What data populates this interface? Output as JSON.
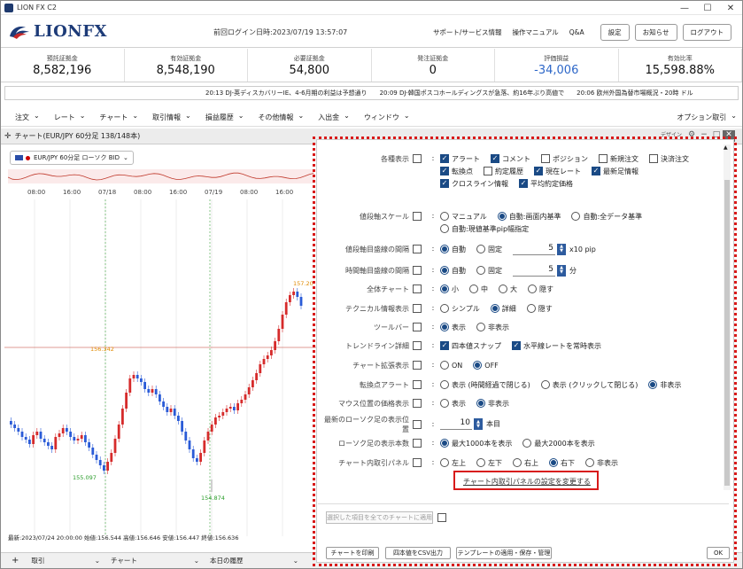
{
  "window": {
    "title": "LION FX C2",
    "btn_min": "—",
    "btn_max": "☐",
    "btn_close": "✕"
  },
  "header": {
    "logo_text": "LIONFX",
    "last_login": "前回ログイン日時:2023/07/19 13:57:07",
    "links": [
      "サポート/サービス情報",
      "操作マニュアル",
      "Q&A"
    ],
    "buttons": [
      "設定",
      "お知らせ",
      "ログアウト"
    ]
  },
  "account": [
    {
      "label": "預託証拠金",
      "value": "8,582,196"
    },
    {
      "label": "有効証拠金",
      "value": "8,548,190"
    },
    {
      "label": "必要証拠金",
      "value": "54,800"
    },
    {
      "label": "発注証拠金",
      "value": "0"
    },
    {
      "label": "評価損益",
      "value": "-34,006"
    },
    {
      "label": "有効比率",
      "value": "15,598.88%"
    }
  ],
  "ticker": [
    "20:13 DJ-英ディスカバリーIE、4-6月期の利益は予想通り",
    "20:09 DJ-韓国ポスコホールディングスが急落、約16年ぶり高値で",
    "20:06 欧州外国為替市場概況・20時 ドル"
  ],
  "menu": [
    "注文",
    "レート",
    "チャート",
    "取引情報",
    "損益履歴",
    "その他情報",
    "入出金",
    "ウィンドウ"
  ],
  "menu_right": "オプション取引",
  "chart": {
    "title": "チャート(EUR/JPY 60分足 138/148本)",
    "symbol": "EUR/JPY 60分足 ローソク BID",
    "time_labels": [
      "08:00",
      "16:00",
      "07/18",
      "08:00",
      "16:00",
      "07/19",
      "08:00",
      "16:00"
    ],
    "price_labels": [
      "157.20",
      "156.342",
      "155.097",
      "154.874"
    ],
    "status": "最新:2023/07/24 20:00:00 始値:156.544 高値:156.646 安値:156.447 終値:156.636",
    "colors": {
      "up": "#d62b2b",
      "down": "#2a5bd7",
      "high": "#e08a00",
      "low": "#2a9d2a"
    },
    "ctl": [
      "デザイン",
      "⚙",
      "−",
      "□",
      "✕"
    ]
  },
  "bottom_tabs": [
    "取引",
    "チャート",
    "本日の履歴"
  ],
  "settings": {
    "rows": [
      {
        "label": "各種表示",
        "checked": false,
        "opts": [
          {
            "t": "アラート",
            "k": "cb",
            "on": true
          },
          {
            "t": "コメント",
            "k": "cb",
            "on": true
          },
          {
            "t": "ポジション",
            "k": "cb",
            "on": false
          },
          {
            "t": "新規注文",
            "k": "cb",
            "on": false
          },
          {
            "t": "決済注文",
            "k": "cb",
            "on": false
          },
          {
            "t": "転換点",
            "k": "cb",
            "on": true
          },
          {
            "t": "約定履歴",
            "k": "cb",
            "on": false
          },
          {
            "t": "現在レート",
            "k": "cb",
            "on": true
          },
          {
            "t": "最新足情報",
            "k": "cb",
            "on": true
          },
          {
            "t": "クロスライン情報",
            "k": "cb",
            "on": true
          },
          {
            "t": "平均約定価格",
            "k": "cb",
            "on": true
          }
        ]
      },
      {
        "label": "値段軸スケール",
        "checked": false,
        "opts": [
          {
            "t": "マニュアル",
            "k": "rb",
            "on": false
          },
          {
            "t": "自動:画面内基準",
            "k": "rb",
            "on": true
          },
          {
            "t": "自動:全データ基準",
            "k": "rb",
            "on": false
          },
          {
            "t": "自動:現値基準pip幅指定",
            "k": "rb",
            "on": false
          }
        ]
      },
      {
        "label": "値段軸目盛線の間隔",
        "checked": false,
        "opts": [
          {
            "t": "自動",
            "k": "rb",
            "on": true
          },
          {
            "t": "固定",
            "k": "rb",
            "on": false
          }
        ],
        "num": "5",
        "unit": "x10 pip"
      },
      {
        "label": "時間軸目盛線の間隔",
        "checked": false,
        "opts": [
          {
            "t": "自動",
            "k": "rb",
            "on": true
          },
          {
            "t": "固定",
            "k": "rb",
            "on": false
          }
        ],
        "num": "5",
        "unit": "分"
      },
      {
        "label": "全体チャート",
        "checked": false,
        "opts": [
          {
            "t": "小",
            "k": "rb",
            "on": true
          },
          {
            "t": "中",
            "k": "rb",
            "on": false
          },
          {
            "t": "大",
            "k": "rb",
            "on": false
          },
          {
            "t": "隠す",
            "k": "rb",
            "on": false
          }
        ]
      },
      {
        "label": "テクニカル情報表示",
        "checked": false,
        "opts": [
          {
            "t": "シンプル",
            "k": "rb",
            "on": false
          },
          {
            "t": "詳細",
            "k": "rb",
            "on": true
          },
          {
            "t": "隠す",
            "k": "rb",
            "on": false
          }
        ]
      },
      {
        "label": "ツールバー",
        "checked": false,
        "opts": [
          {
            "t": "表示",
            "k": "rb",
            "on": true
          },
          {
            "t": "非表示",
            "k": "rb",
            "on": false
          }
        ]
      },
      {
        "label": "トレンドライン詳細",
        "checked": false,
        "opts": [
          {
            "t": "四本値スナップ",
            "k": "cb",
            "on": true
          },
          {
            "t": "水平線レートを常時表示",
            "k": "cb",
            "on": true
          }
        ]
      },
      {
        "label": "チャート拡張表示",
        "checked": false,
        "opts": [
          {
            "t": "ON",
            "k": "rb",
            "on": false
          },
          {
            "t": "OFF",
            "k": "rb",
            "on": true
          }
        ]
      },
      {
        "label": "転換点アラート",
        "checked": false,
        "opts": [
          {
            "t": "表示 (時間経過で閉じる)",
            "k": "rb",
            "on": false
          },
          {
            "t": "表示 (クリックして閉じる)",
            "k": "rb",
            "on": false
          },
          {
            "t": "非表示",
            "k": "rb",
            "on": true
          }
        ]
      },
      {
        "label": "マウス位置の価格表示",
        "checked": false,
        "opts": [
          {
            "t": "表示",
            "k": "rb",
            "on": false
          },
          {
            "t": "非表示",
            "k": "rb",
            "on": true
          }
        ]
      },
      {
        "label": "最新のローソク足の表示位置",
        "checked": false,
        "opts": [],
        "num": "10",
        "unit": "本目"
      },
      {
        "label": "ローソク足の表示本数",
        "checked": false,
        "opts": [
          {
            "t": "最大1000本を表示",
            "k": "rb",
            "on": true
          },
          {
            "t": "最大2000本を表示",
            "k": "rb",
            "on": false
          }
        ]
      },
      {
        "label": "チャート内取引パネル",
        "checked": false,
        "opts": [
          {
            "t": "左上",
            "k": "rb",
            "on": false
          },
          {
            "t": "左下",
            "k": "rb",
            "on": false
          },
          {
            "t": "右上",
            "k": "rb",
            "on": false
          },
          {
            "t": "右下",
            "k": "rb",
            "on": true
          },
          {
            "t": "非表示",
            "k": "rb",
            "on": false
          }
        ]
      }
    ],
    "link": "チャート内取引パネルの設定を変更する",
    "apply_all": "選択した項目を全てのチャートに適用",
    "footer": [
      "チャートを印刷",
      "四本値をCSV出力",
      "テンプレートの適用・保存・管理",
      "OK"
    ]
  }
}
